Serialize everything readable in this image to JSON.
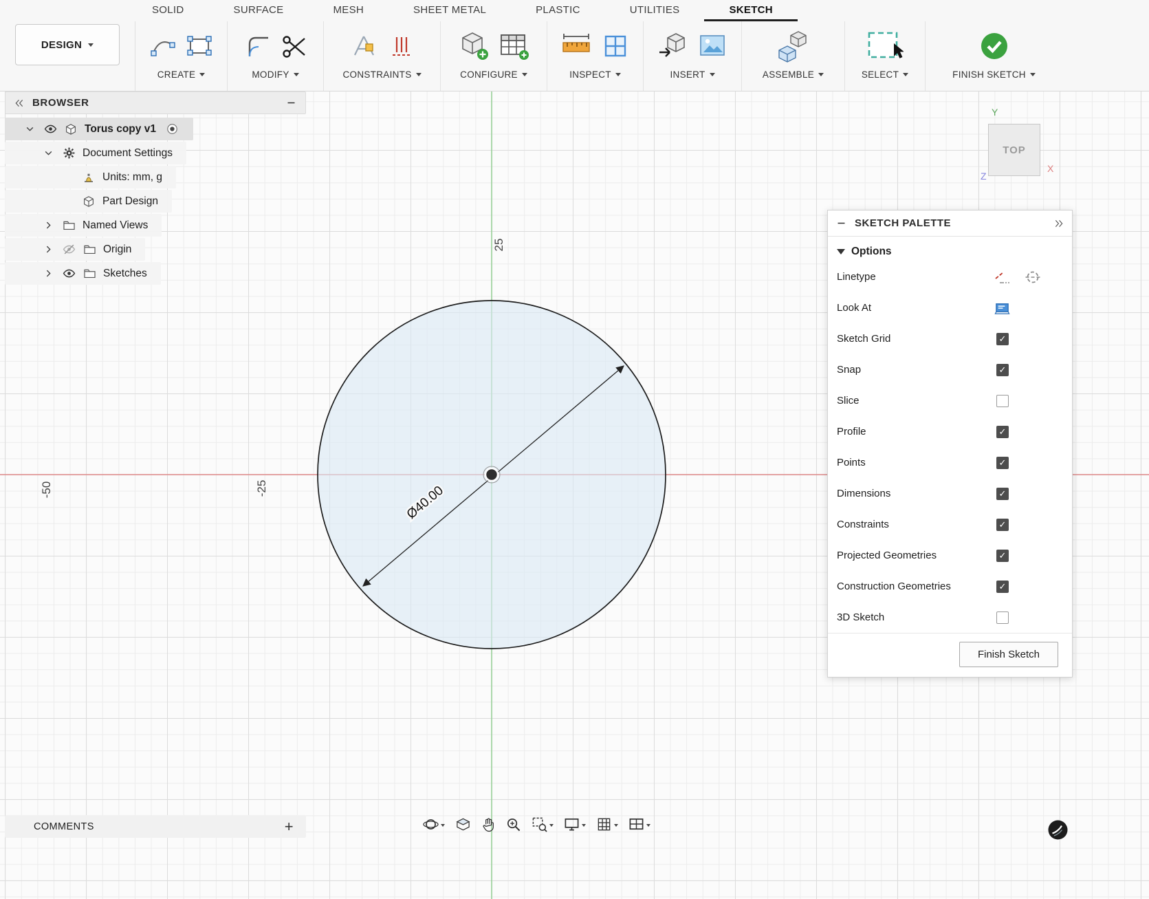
{
  "titlebar": {
    "design_label": "DESIGN"
  },
  "ribbon": {
    "tabs": [
      {
        "label": "SOLID",
        "active": false
      },
      {
        "label": "SURFACE",
        "active": false
      },
      {
        "label": "MESH",
        "active": false
      },
      {
        "label": "SHEET METAL",
        "active": false
      },
      {
        "label": "PLASTIC",
        "active": false
      },
      {
        "label": "UTILITIES",
        "active": false
      },
      {
        "label": "SKETCH",
        "active": true
      }
    ],
    "groups": [
      {
        "label": "CREATE",
        "icons": [
          "spline",
          "rect-tool"
        ]
      },
      {
        "label": "MODIFY",
        "icons": [
          "fillet",
          "scissors"
        ]
      },
      {
        "label": "CONSTRAINTS",
        "icons": [
          "constraint-sketch",
          "constraint-lines"
        ]
      },
      {
        "label": "CONFIGURE",
        "icons": [
          "cube-plus",
          "table-plus"
        ]
      },
      {
        "label": "INSPECT",
        "icons": [
          "measure",
          "frame"
        ]
      },
      {
        "label": "INSERT",
        "icons": [
          "insert-cube",
          "image"
        ]
      },
      {
        "label": "ASSEMBLE",
        "icons": [
          "assemble-cubes"
        ]
      },
      {
        "label": "SELECT",
        "icons": [
          "select-box"
        ]
      },
      {
        "label": "FINISH SKETCH",
        "icons": [
          "finish-check"
        ]
      }
    ]
  },
  "browser": {
    "title": "BROWSER",
    "rows": [
      {
        "label": "Torus copy v1",
        "caret": "down",
        "icons": [
          "eye",
          "document"
        ],
        "bold": true,
        "trailing": "radio",
        "indent": 0
      },
      {
        "label": "Document Settings",
        "caret": "down",
        "icons": [
          "gear"
        ],
        "indent": 1
      },
      {
        "label": "Units: mm, g",
        "caret": "none",
        "icons": [
          "units"
        ],
        "indent": 2
      },
      {
        "label": "Part Design",
        "caret": "none",
        "icons": [
          "document"
        ],
        "indent": 2
      },
      {
        "label": "Named Views",
        "caret": "right",
        "icons": [
          "folder"
        ],
        "indent": 1
      },
      {
        "label": "Origin",
        "caret": "right",
        "icons": [
          "eye-off",
          "folder"
        ],
        "indent": 1
      },
      {
        "label": "Sketches",
        "caret": "right",
        "icons": [
          "eye",
          "folder"
        ],
        "indent": 1
      }
    ]
  },
  "palette": {
    "title": "SKETCH PALETTE",
    "options_header": "Options",
    "rows": [
      {
        "label": "Linetype",
        "control": "linetype"
      },
      {
        "label": "Look At",
        "control": "look-at"
      },
      {
        "label": "Sketch Grid",
        "control": "checkbox",
        "checked": true
      },
      {
        "label": "Snap",
        "control": "checkbox",
        "checked": true
      },
      {
        "label": "Slice",
        "control": "checkbox",
        "checked": false
      },
      {
        "label": "Profile",
        "control": "checkbox",
        "checked": true
      },
      {
        "label": "Points",
        "control": "checkbox",
        "checked": true
      },
      {
        "label": "Dimensions",
        "control": "checkbox",
        "checked": true
      },
      {
        "label": "Constraints",
        "control": "checkbox",
        "checked": true
      },
      {
        "label": "Projected Geometries",
        "control": "checkbox",
        "checked": true
      },
      {
        "label": "Construction Geometries",
        "control": "checkbox",
        "checked": true
      },
      {
        "label": "3D Sketch",
        "control": "checkbox",
        "checked": false
      }
    ],
    "finish_button": "Finish Sketch"
  },
  "canvas": {
    "dimension_label": "Ø40.00",
    "axis_labels": {
      "top": "25",
      "left": "-50",
      "mid_left": "-25"
    },
    "viewcube": {
      "face": "TOP",
      "x": "X",
      "y": "Y",
      "z": "Z"
    }
  },
  "comments": {
    "label": "COMMENTS",
    "add_label": "+"
  },
  "dock": {
    "items": [
      {
        "name": "orbit",
        "caret": true
      },
      {
        "name": "look-at",
        "caret": false
      },
      {
        "name": "pan",
        "caret": false
      },
      {
        "name": "zoom",
        "caret": false
      },
      {
        "name": "zoom-window",
        "caret": true
      },
      {
        "name": "display-settings",
        "caret": true
      },
      {
        "name": "grid-settings",
        "caret": true
      },
      {
        "name": "viewports",
        "caret": true
      }
    ]
  },
  "colors": {
    "accent_green": "#3ba23f",
    "axis_x": "#dd7777",
    "axis_y": "#8fcf8f",
    "profile_fill": "#dbeaf5"
  }
}
